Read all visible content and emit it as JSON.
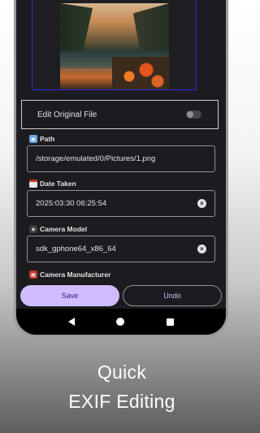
{
  "toggle": {
    "label": "Edit Original File",
    "checked": false
  },
  "fields": {
    "path": {
      "label": "Path",
      "icon": "framed-picture-icon",
      "value": "/storage/emulated/0/Pictures/1.png"
    },
    "date": {
      "label": "Date Taken",
      "icon": "calendar-icon",
      "value": "2025:03:30 06:25:54"
    },
    "model": {
      "label": "Camera Model",
      "icon": "camera-icon",
      "value": "sdk_gphone64_x86_64"
    },
    "manufacturer": {
      "label": "Camera Manufacturer",
      "icon": "factory-icon"
    }
  },
  "buttons": {
    "save": "Save",
    "undo": "Undo"
  },
  "caption": {
    "line1": "Quick",
    "line2": "EXIF Editing"
  },
  "colors": {
    "accent": "#d0bcff",
    "surface": "#1c1b1f",
    "preview_border": "#2b2be0"
  }
}
